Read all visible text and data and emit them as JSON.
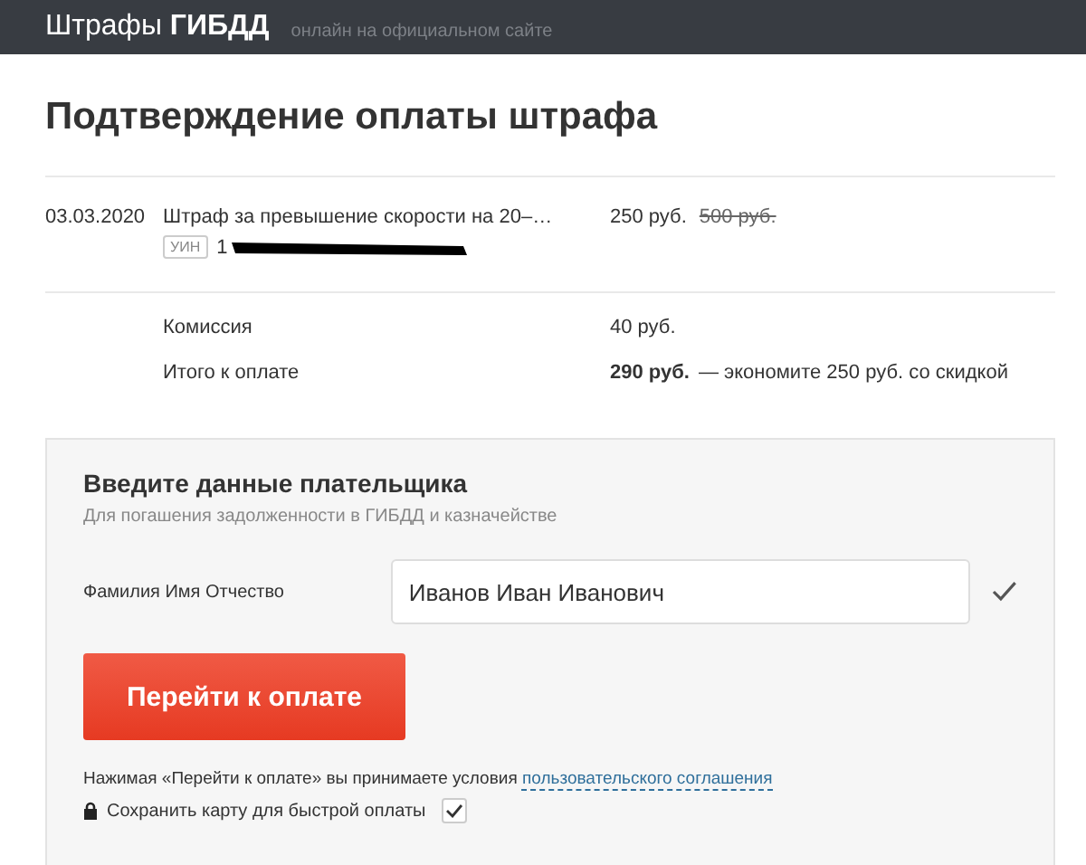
{
  "header": {
    "brand": "Штрафы",
    "brand_bold": "ГИБДД",
    "tagline": "онлайн на официальном сайте"
  },
  "title": "Подтверждение оплаты штрафа",
  "fine": {
    "date": "03.03.2020",
    "description": "Штраф за превышение скорости на 20–…",
    "price": "250 руб.",
    "old_price": "500 руб.",
    "uin_label": "УИН",
    "uin": "1"
  },
  "summary": [
    {
      "label": "Комиссия",
      "value": "40 руб."
    },
    {
      "label": "Итого к оплате",
      "value": "290 руб.",
      "note": "— экономите 250 руб. со скидкой"
    }
  ],
  "payer": {
    "heading": "Введите данные плательщика",
    "subtitle": "Для погашения задолженности в ГИБДД и казначействе",
    "field_label": "Фамилия Имя Отчество",
    "field_value": "Иванов Иван Иванович",
    "valid": true,
    "button": "Перейти к оплате",
    "terms": "Нажимая «Перейти к оплате» вы принимаете условия",
    "terms_link": "пользовательского соглашения",
    "save_card": "Сохранить карту для быстрой оплаты",
    "save_card_checked": true
  }
}
